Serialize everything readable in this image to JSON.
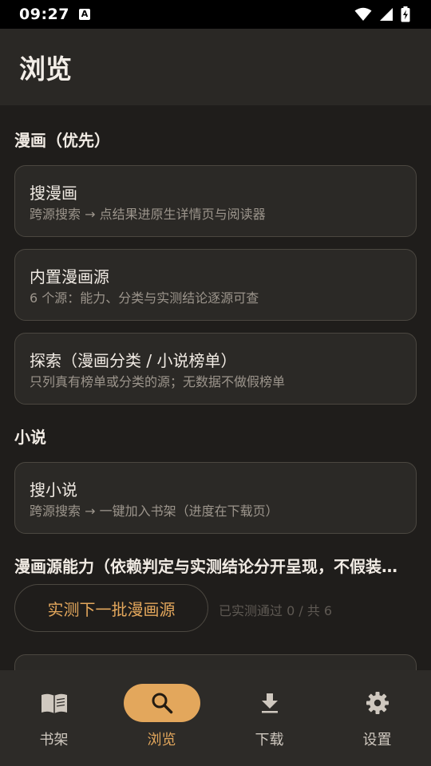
{
  "status_bar": {
    "time": "09:27",
    "notification_glyph": "A",
    "icons": [
      "wifi-icon",
      "signal-icon",
      "battery-charging-icon"
    ]
  },
  "app_bar": {
    "title": "浏览"
  },
  "sections": {
    "manga": {
      "title": "漫画（优先）",
      "cards": [
        {
          "title": "搜漫画",
          "subtitle": "跨源搜索 → 点结果进原生详情页与阅读器"
        },
        {
          "title": "内置漫画源",
          "subtitle": "6 个源：能力、分类与实测结论逐源可查"
        },
        {
          "title": "探索（漫画分类 / 小说榜单）",
          "subtitle": "只列真有榜单或分类的源；无数据不做假榜单"
        }
      ]
    },
    "novel": {
      "title": "小说",
      "cards": [
        {
          "title": "搜小说",
          "subtitle": "跨源搜索 → 一键加入书架（进度在下载页）"
        }
      ]
    },
    "capability": {
      "title": "漫画源能力（依赖判定与实测结论分开呈现，不假装…",
      "test_button_label": "实测下一批漫画源",
      "test_status": "已实测通过 0 / 共 6"
    }
  },
  "nav": {
    "items": [
      {
        "label": "书架",
        "icon": "book-icon",
        "active": false
      },
      {
        "label": "浏览",
        "icon": "search-icon",
        "active": true
      },
      {
        "label": "下载",
        "icon": "download-icon",
        "active": false
      },
      {
        "label": "设置",
        "icon": "gear-icon",
        "active": false
      }
    ]
  },
  "colors": {
    "background": "#1f1d1b",
    "app_bar": "#2a2825",
    "card": "#2b2926",
    "accent": "#e3a75c",
    "nav_bar": "#2d2b28"
  }
}
